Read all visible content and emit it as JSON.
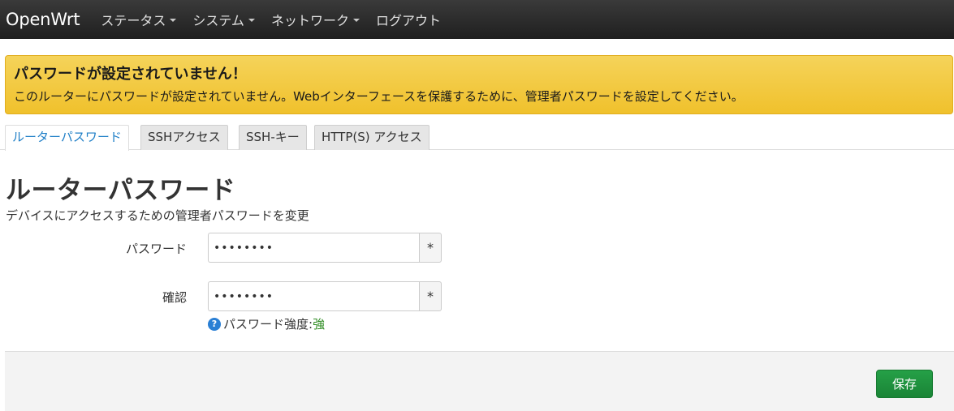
{
  "navbar": {
    "brand": "OpenWrt",
    "menu": [
      {
        "label": "ステータス"
      },
      {
        "label": "システム"
      },
      {
        "label": "ネットワーク"
      },
      {
        "label": "ログアウト"
      }
    ]
  },
  "alert": {
    "title": "パスワードが設定されていません！",
    "text": "このルーターにパスワードが設定されていません。Webインターフェースを保護するために、管理者パスワードを設定してください。"
  },
  "tabs": [
    {
      "label": "ルーターパスワード",
      "active": true
    },
    {
      "label": "SSHアクセス",
      "active": false
    },
    {
      "label": "SSH-キー",
      "active": false
    },
    {
      "label": "HTTP(S) アクセス",
      "active": false
    }
  ],
  "section": {
    "title": "ルーターパスワード",
    "description": "デバイスにアクセスするための管理者パスワードを変更"
  },
  "form": {
    "password": {
      "label": "パスワード",
      "value": "••••••••",
      "reveal": "*"
    },
    "confirm": {
      "label": "確認",
      "value": "••••••••",
      "reveal": "*"
    },
    "strength": {
      "icon": "?",
      "label": "パスワード強度: ",
      "value": "強"
    }
  },
  "footer": {
    "save_label": "保存"
  },
  "colors": {
    "navbar": "#2b2b2b",
    "alert": "#f1c232",
    "active_tab_text": "#1f7fc7",
    "strength_strong": "#2e8b22",
    "save_button": "#1f8f3c"
  },
  "icons": {
    "menu_caret": "caret-down-icon",
    "help": "help-icon"
  }
}
